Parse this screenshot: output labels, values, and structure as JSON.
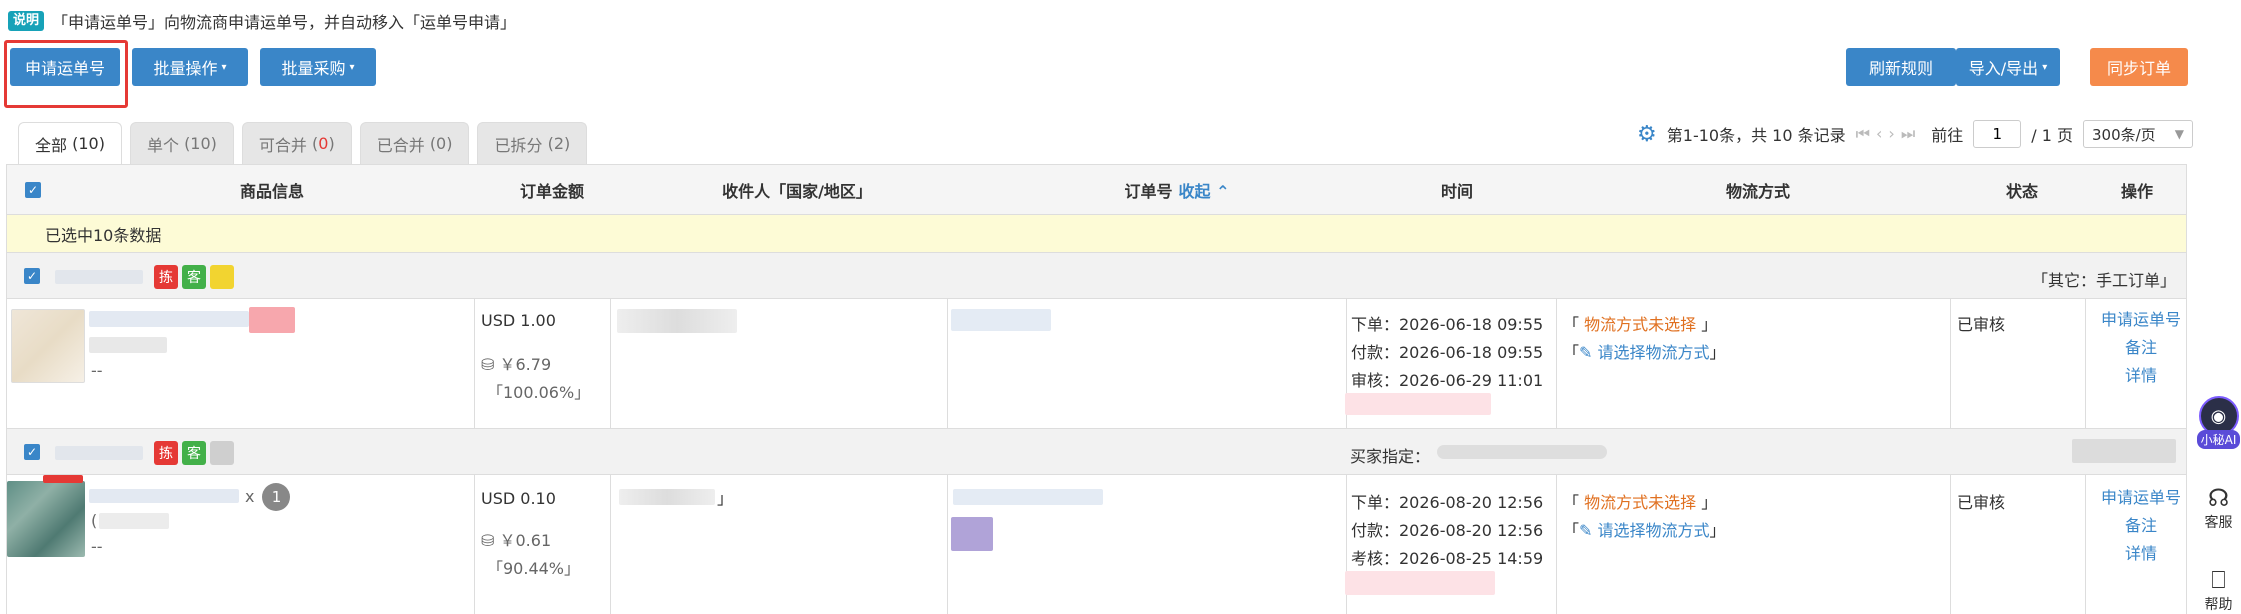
{
  "notice": {
    "tag": "说明",
    "text": "「申请运单号」向物流商申请运单号，并自动移入「运单号申请」"
  },
  "toolbar": {
    "apply_waybill": "申请运单号",
    "batch_ops": "批量操作",
    "batch_purchase": "批量采购",
    "refresh_rules": "刷新规则",
    "import_export": "导入/导出",
    "sync_orders": "同步订单"
  },
  "tabs": [
    {
      "label": "全部",
      "count": "(10)"
    },
    {
      "label": "单个",
      "count": "(10)"
    },
    {
      "label": "可合并",
      "count_open": "(",
      "count_num": "0",
      "count_close": ")"
    },
    {
      "label": "已合并",
      "count": "(0)"
    },
    {
      "label": "已拆分",
      "count": "(2)"
    }
  ],
  "pager": {
    "summary": "第1-10条，共 10 条记录",
    "goto_label": "前往",
    "current_page": "1",
    "total_label": "/ 1 页",
    "page_size": "300条/页"
  },
  "table": {
    "headers": {
      "product": "商品信息",
      "amount": "订单金额",
      "recipient": "收件人「国家/地区」",
      "order_no": "订单号",
      "collapse": "收起",
      "time": "时间",
      "logistics": "物流方式",
      "status": "状态",
      "ops": "操作"
    },
    "selected_text": "已选中10条数据",
    "groups": [
      {
        "tags": [
          "拣",
          "客"
        ],
        "right_text": "「其它：手工订单」",
        "row": {
          "dash": "--",
          "amount": "USD 1.00",
          "cost": "￥6.79",
          "margin": "「100.06%」",
          "times": [
            "下单：2026-06-18 09:55",
            "付款：2026-06-18 09:55",
            "审核：2026-06-29 11:01"
          ],
          "logistics_unset_open": "「",
          "logistics_unset": "物流方式未选择",
          "logistics_unset_close": "」",
          "logistics_choose_open": "「",
          "logistics_choose": "请选择物流方式",
          "logistics_choose_close": "」",
          "status": "已审核",
          "ops": [
            "申请运单号",
            "备注",
            "详情"
          ]
        }
      },
      {
        "tags": [
          "拣",
          "客"
        ],
        "buyer_label": "买家指定：",
        "row": {
          "qty_prefix": "x",
          "qty": "1",
          "paren": "(",
          "dash": "--",
          "amount": "USD 0.10",
          "cost": "￥0.61",
          "margin": "「90.44%」",
          "recipient_close": "」",
          "times": [
            "下单：2026-08-20 12:56",
            "付款：2026-08-20 12:56",
            "考核：2026-08-25 14:59"
          ],
          "logistics_unset_open": "「",
          "logistics_unset": "物流方式未选择",
          "logistics_unset_close": "」",
          "logistics_choose_open": "「",
          "logistics_choose": "请选择物流方式",
          "logistics_choose_close": "」",
          "status": "已审核",
          "ops": [
            "申请运单号",
            "备注",
            "详情"
          ]
        }
      }
    ]
  },
  "side": {
    "ai": "小秘AI",
    "service": "客服",
    "help": "帮助"
  },
  "colors": {
    "primary": "#3a86c8",
    "orange": "#f58a4b",
    "highlight": "#e53935",
    "notice_bg": "#fdfbd6"
  }
}
